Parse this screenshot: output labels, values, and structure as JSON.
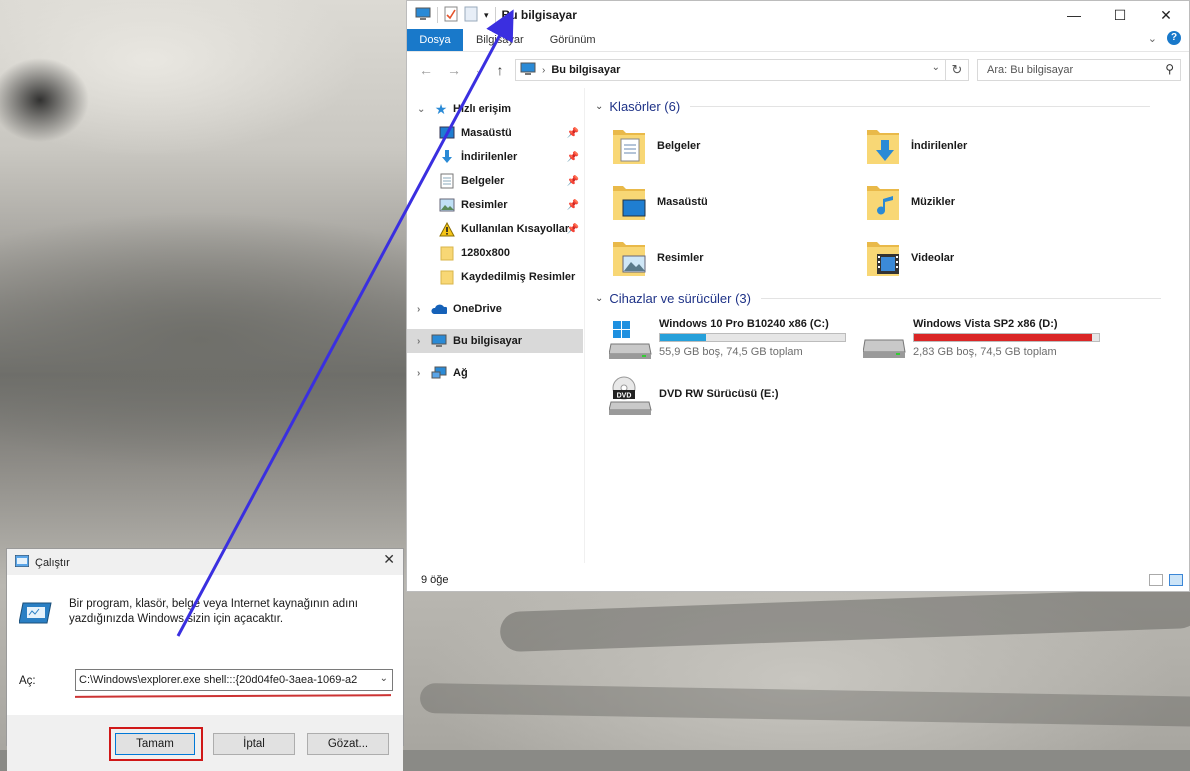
{
  "explorer": {
    "title": "Bu bilgisayar",
    "ribbon_tabs": [
      "Dosya",
      "Bilgisayar",
      "Görünüm"
    ],
    "address": "Bu bilgisayar",
    "search_placeholder": "Ara: Bu bilgisayar",
    "nav": {
      "quick_access": "Hızlı erişim",
      "items": [
        {
          "label": "Masaüstü",
          "icon": "desktop-icon"
        },
        {
          "label": "İndirilenler",
          "icon": "downloads-icon"
        },
        {
          "label": "Belgeler",
          "icon": "documents-icon"
        },
        {
          "label": "Resimler",
          "icon": "pictures-icon"
        },
        {
          "label": "Kullanılan Kısayollar",
          "icon": "warning-icon"
        },
        {
          "label": "1280x800",
          "icon": "folder-icon"
        },
        {
          "label": "Kaydedilmiş Resimler",
          "icon": "folder-icon"
        }
      ],
      "onedrive": "OneDrive",
      "this_pc": "Bu bilgisayar",
      "network": "Ağ"
    },
    "folders_header": "Klasörler (6)",
    "folders": [
      {
        "name": "Belgeler",
        "overlay": "document"
      },
      {
        "name": "İndirilenler",
        "overlay": "download"
      },
      {
        "name": "Masaüstü",
        "overlay": "desktop"
      },
      {
        "name": "Müzikler",
        "overlay": "music"
      },
      {
        "name": "Resimler",
        "overlay": "picture"
      },
      {
        "name": "Videolar",
        "overlay": "video"
      }
    ],
    "devices_header": "Cihazlar ve sürücüler (3)",
    "drives": [
      {
        "name": "Windows 10 Pro B10240 x86 (C:)",
        "info": "55,9 GB boş, 74,5 GB toplam",
        "used_fraction": 0.25,
        "color": "#26a0da"
      },
      {
        "name": "Windows Vista SP2 x86 (D:)",
        "info": "2,83 GB boş, 74,5 GB toplam",
        "used_fraction": 0.96,
        "color": "#da2626"
      },
      {
        "name": "DVD RW Sürücüsü (E:)",
        "dvd_label": "DVD"
      }
    ],
    "status": "9 öğe"
  },
  "run": {
    "title": "Çalıştır",
    "description": "Bir program, klasör, belge veya Internet kaynağının adını yazdığınızda Windows sizin için açacaktır.",
    "open_label": "Aç:",
    "command": "C:\\Windows\\explorer.exe shell:::{20d04fe0-3aea-1069-a2",
    "ok": "Tamam",
    "cancel": "İptal",
    "browse": "Gözat..."
  },
  "colors": {
    "accent": "#1979ca",
    "annotation_arrow": "#3a2fe0",
    "highlight": "#d01818"
  }
}
